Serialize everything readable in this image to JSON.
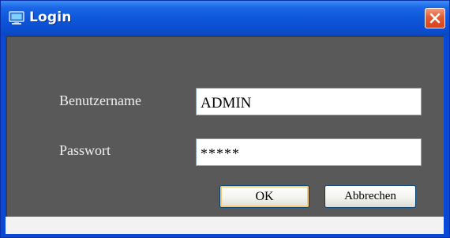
{
  "window": {
    "title": "Login",
    "icon": "monitor-icon",
    "close_icon": "close-icon",
    "colors": {
      "titlebar": "#0d55d9",
      "client_background": "#595959",
      "close_button": "#e45a30"
    }
  },
  "form": {
    "username_label": "Benutzername",
    "username_value": "ADMIN",
    "password_label": "Passwort",
    "password_value": "*****",
    "ok_label": "OK",
    "cancel_label": "Abbrechen"
  }
}
